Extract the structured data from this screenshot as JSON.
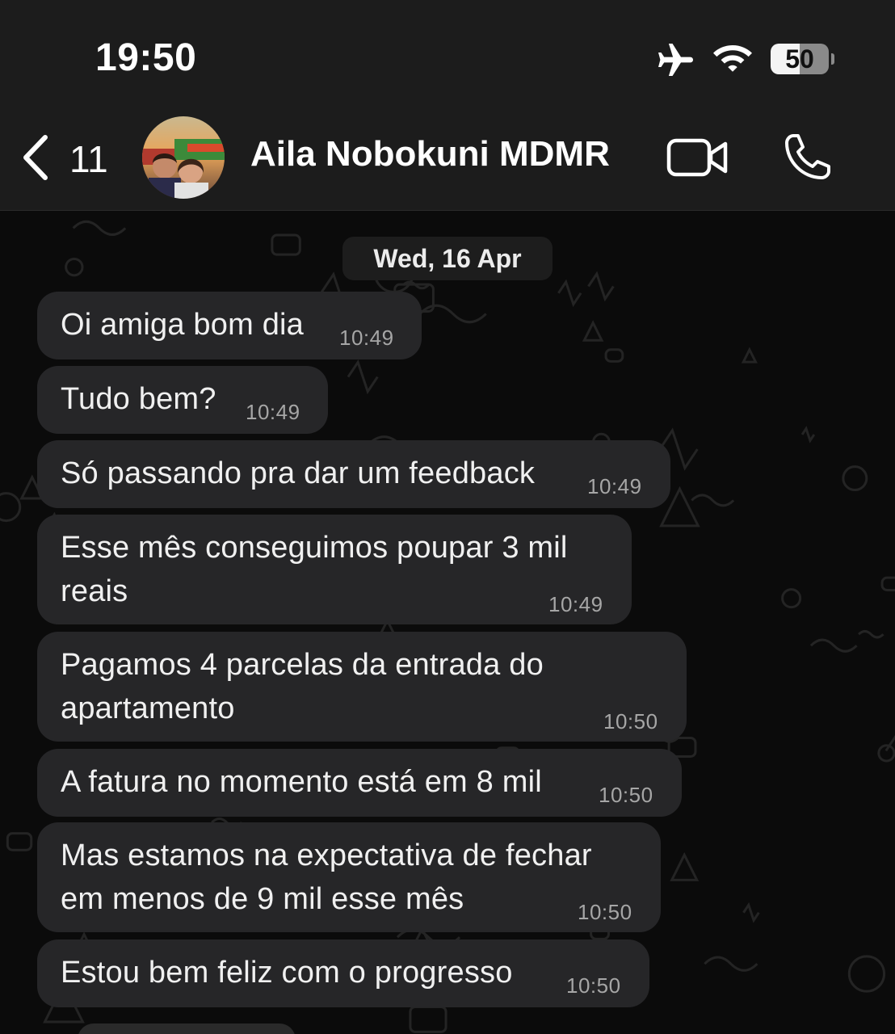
{
  "status_bar": {
    "time": "19:50",
    "battery": "50",
    "battery_level": 0.5,
    "icons": [
      "airplane-icon",
      "wifi-icon",
      "battery-icon"
    ]
  },
  "header": {
    "back_count": "11",
    "contact_name": "Aila Nobokuni MDMR",
    "icons": [
      "back-chevron-icon",
      "video-camera-icon",
      "phone-icon"
    ]
  },
  "chat": {
    "date_label": "Wed, 16 Apr",
    "messages": [
      {
        "lines": [
          "Oi amiga bom dia"
        ],
        "time": "10:49"
      },
      {
        "lines": [
          "Tudo bem?"
        ],
        "time": "10:49"
      },
      {
        "lines": [
          "Só passando pra dar um feedback"
        ],
        "time": "10:49"
      },
      {
        "lines": [
          "Esse mês conseguimos poupar 3 mil",
          "reais"
        ],
        "time": "10:49"
      },
      {
        "lines": [
          "Pagamos 4 parcelas da entrada do",
          "apartamento"
        ],
        "time": "10:50"
      },
      {
        "lines": [
          "A fatura no momento está em 8 mil"
        ],
        "time": "10:50"
      },
      {
        "lines": [
          "Mas estamos na expectativa de fechar",
          "em menos de 9 mil esse mês"
        ],
        "time": "10:50"
      },
      {
        "lines": [
          "Estou bem feliz com o progresso"
        ],
        "time": "10:50"
      }
    ]
  },
  "colors": {
    "bar_background": "#1c1c1c",
    "bubble_background": "#262628",
    "chat_background": "#0b0b0b"
  }
}
